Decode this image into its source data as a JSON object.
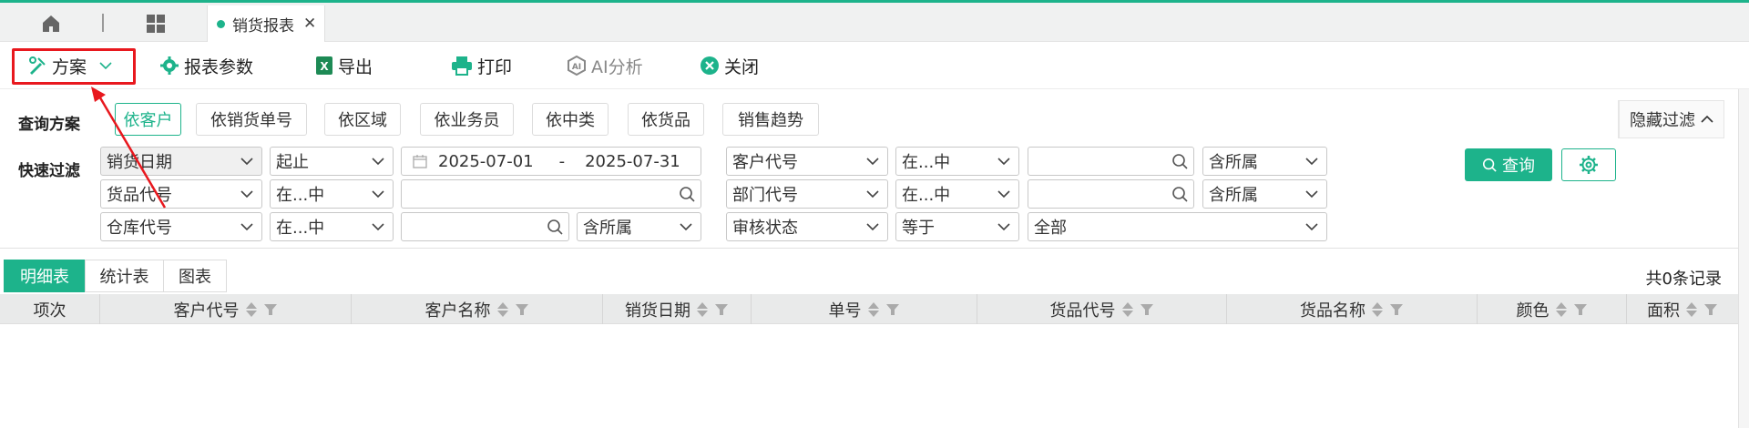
{
  "tabs": {
    "active_tab_label": "销货报表"
  },
  "toolbar": {
    "scheme_label": "方案",
    "params_label": "报表参数",
    "export_label": "导出",
    "print_label": "打印",
    "ai_label": "AI分析",
    "close_label": "关闭"
  },
  "query_scheme": {
    "label": "查询方案",
    "options": [
      "依客户",
      "依销货单号",
      "依区域",
      "依业务员",
      "依中类",
      "依货品",
      "销售趋势"
    ],
    "active": "依客户",
    "hide_filter_label": "隐藏过滤"
  },
  "quick_filter": {
    "label": "快速过滤",
    "rows": [
      {
        "field": "销货日期",
        "op": "起止",
        "date_from": "2025-07-01",
        "date_sep": "-",
        "date_to": "2025-07-31"
      },
      {
        "field": "货品代号",
        "op": "在...中",
        "value": ""
      },
      {
        "field": "仓库代号",
        "op": "在...中",
        "value": "",
        "scope": "含所属"
      }
    ],
    "right_rows": [
      {
        "field": "客户代号",
        "op": "在...中",
        "value": "",
        "scope": "含所属"
      },
      {
        "field": "部门代号",
        "op": "在...中",
        "value": "",
        "scope": "含所属"
      },
      {
        "field": "审核状态",
        "op": "等于",
        "value": "全部"
      }
    ],
    "query_label": "查询"
  },
  "view_tabs": [
    "明细表",
    "统计表",
    "图表"
  ],
  "record_count": "共0条记录",
  "table": {
    "columns": [
      "项次",
      "客户代号",
      "客户名称",
      "销货日期",
      "单号",
      "货品代号",
      "货品名称",
      "颜色",
      "面积"
    ]
  },
  "colors": {
    "accent": "#1db38b",
    "highlight_box": "#e8181e"
  },
  "icons": [
    "home-icon",
    "apps-grid-icon",
    "close-icon",
    "scheme-icon",
    "chevron-down-icon",
    "gear-icon",
    "excel-icon",
    "printer-icon",
    "ai-icon",
    "close-circle-icon",
    "search-icon",
    "calendar-icon",
    "sort-icon",
    "filter-icon"
  ]
}
